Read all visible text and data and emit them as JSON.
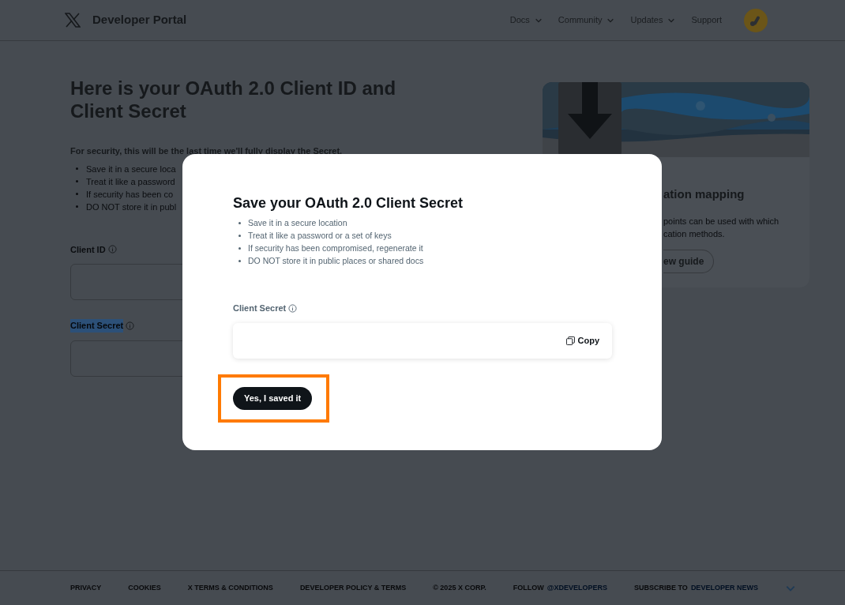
{
  "header": {
    "title": "Developer Portal",
    "nav": [
      {
        "label": "Docs",
        "has_menu": true
      },
      {
        "label": "Community",
        "has_menu": true
      },
      {
        "label": "Updates",
        "has_menu": true
      },
      {
        "label": "Support",
        "has_menu": false
      }
    ]
  },
  "page": {
    "title": "Here is your OAuth 2.0 Client ID and Client Secret",
    "notice": "For security, this will be the last time we'll fully display the Secret.",
    "bullets": [
      "Save it in a secure loca",
      "Treat it like a password",
      "If security has been co",
      "DO NOT store it in publ"
    ],
    "fields": [
      {
        "label": "Client ID",
        "selected": false
      },
      {
        "label": "Client Secret",
        "selected": true
      }
    ]
  },
  "card": {
    "title": "ation mapping",
    "lines": [
      "points can be used with which",
      "cation methods."
    ],
    "button": "ew guide"
  },
  "modal": {
    "title": "Save your OAuth 2.0 Client Secret",
    "bullets": [
      "Save it in a secure location",
      "Treat it like a password or a set of keys",
      "If security has been compromised, regenerate it",
      "DO NOT store it in public places or shared docs"
    ],
    "field_label": "Client Secret",
    "copy": "Copy",
    "confirm": "Yes, I saved it",
    "highlighted": true
  },
  "footer": [
    {
      "text": "PRIVACY"
    },
    {
      "text": "COOKIES"
    },
    {
      "text": "X TERMS & CONDITIONS"
    },
    {
      "text": "DEVELOPER POLICY & TERMS"
    },
    {
      "text": "© 2025 X CORP."
    },
    {
      "text": "FOLLOW",
      "link": "@XDEVELOPERS"
    },
    {
      "text": "SUBSCRIBE TO",
      "link": "DEVELOPER NEWS"
    }
  ]
}
